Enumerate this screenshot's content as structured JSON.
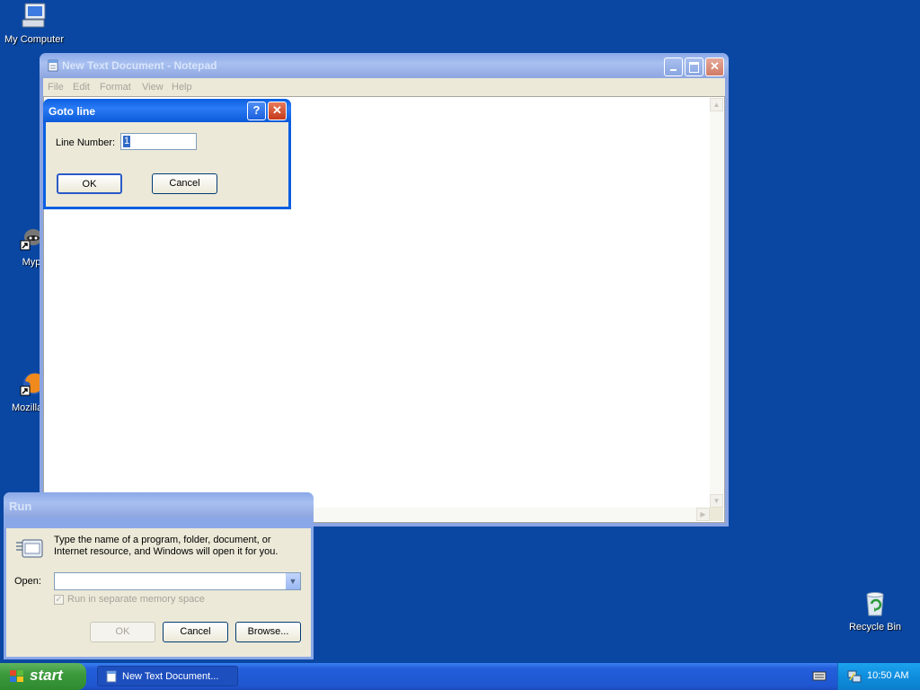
{
  "desktop": {
    "icons": {
      "my_computer": "My Computer",
      "myp": "Myp",
      "mozilla": "Mozilla F",
      "recycle_bin": "Recycle Bin"
    }
  },
  "notepad": {
    "title": "New Text Document - Notepad",
    "menu": [
      "File",
      "Edit",
      "Format",
      "View",
      "Help"
    ]
  },
  "goto_dialog": {
    "title": "Goto line",
    "line_number_label": "Line Number:",
    "line_number_value": "1",
    "ok_label": "OK",
    "cancel_label": "Cancel"
  },
  "run_dialog": {
    "title": "Run",
    "description": "Type the name of a program, folder, document, or Internet resource, and Windows will open it for you.",
    "open_label": "Open:",
    "open_value": "",
    "checkbox_label": "Run in separate memory space",
    "checkbox_checked": true,
    "ok_label": "OK",
    "cancel_label": "Cancel",
    "browse_label": "Browse..."
  },
  "taskbar": {
    "start_label": "start",
    "task_label": "New Text Document...",
    "clock": "10:50 AM"
  },
  "colors": {
    "desktop": "#0a47a2",
    "title_active": "#0a5fe0",
    "title_inactive": "#8aa8e8",
    "dialog_face": "#ece9d8",
    "start_green": "#3c9a3c",
    "taskbar_blue": "#245edb"
  }
}
